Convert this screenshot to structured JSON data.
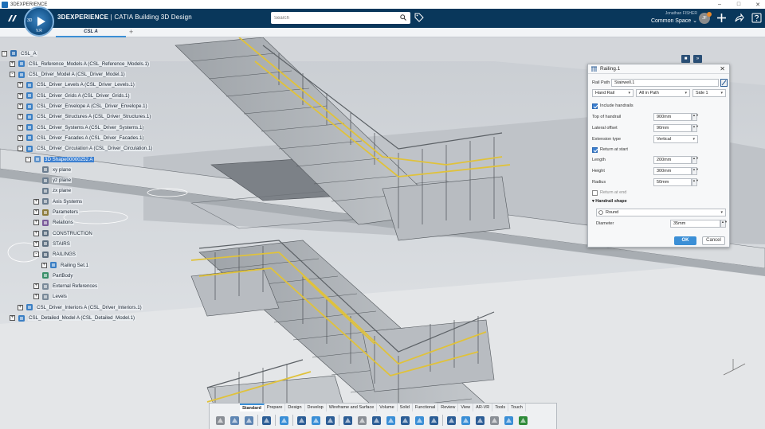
{
  "window": {
    "title": "3DEXPERIENCE",
    "controls": {
      "minimize": "–",
      "maximize": "□",
      "close": "✕"
    }
  },
  "header": {
    "brand_bold": "3DEXPERIENCE",
    "brand_rest": " | CATIA Building 3D Design",
    "compass_version": "V.R",
    "compass_side": "3D",
    "search_placeholder": "Search",
    "user_name": "Jonathan FISHER",
    "space": "Common Space",
    "space_chevron": "⌄",
    "avatar_initials": "JF",
    "accent": "#09375b"
  },
  "tabs": {
    "active_label": "CSL A",
    "add_label": "+"
  },
  "tree": {
    "rows": [
      {
        "level": 0,
        "toggle": "-",
        "icon": "product-root",
        "label": "CSL_A",
        "selected": false
      },
      {
        "level": 1,
        "toggle": "+",
        "icon": "product",
        "label": "CSL_Reference_Models A (CSL_Reference_Models.1)",
        "selected": false
      },
      {
        "level": 1,
        "toggle": "-",
        "icon": "product",
        "label": "CSL_Driver_Model A (CSL_Driver_Model.1)",
        "selected": false
      },
      {
        "level": 2,
        "toggle": "+",
        "icon": "product",
        "label": "CSL_Driver_Levels A (CSL_Driver_Levels.1)",
        "selected": false
      },
      {
        "level": 2,
        "toggle": "+",
        "icon": "product",
        "label": "CSL_Driver_Grids A (CSL_Driver_Grids.1)",
        "selected": false
      },
      {
        "level": 2,
        "toggle": "+",
        "icon": "product",
        "label": "CSL_Driver_Envelope A (CSL_Driver_Envelope.1)",
        "selected": false
      },
      {
        "level": 2,
        "toggle": "+",
        "icon": "product",
        "label": "CSL_Driver_Structures A (CSL_Driver_Structures.1)",
        "selected": false
      },
      {
        "level": 2,
        "toggle": "+",
        "icon": "product",
        "label": "CSL_Driver_Systems A (CSL_Driver_Systems.1)",
        "selected": false
      },
      {
        "level": 2,
        "toggle": "+",
        "icon": "product",
        "label": "CSL_Driver_Facades A (CSL_Driver_Facades.1)",
        "selected": false
      },
      {
        "level": 2,
        "toggle": "-",
        "icon": "product",
        "label": "CSL_Driver_Circulation A (CSL_Driver_Circulation.1)",
        "selected": false
      },
      {
        "level": 3,
        "toggle": "-",
        "icon": "shape",
        "label": "3D Shape00000252 A",
        "selected": true
      },
      {
        "level": 4,
        "toggle": "",
        "icon": "plane",
        "label": "xy plane",
        "selected": false
      },
      {
        "level": 4,
        "toggle": "",
        "icon": "plane",
        "label": "yz plane",
        "selected": false
      },
      {
        "level": 4,
        "toggle": "",
        "icon": "plane",
        "label": "zx plane",
        "selected": false
      },
      {
        "level": 4,
        "toggle": "+",
        "icon": "axis",
        "label": "Axis Systems",
        "selected": false
      },
      {
        "level": 4,
        "toggle": "+",
        "icon": "parameters",
        "label": "Parameters",
        "selected": false
      },
      {
        "level": 4,
        "toggle": "+",
        "icon": "relations",
        "label": "Relations",
        "selected": false
      },
      {
        "level": 4,
        "toggle": "+",
        "icon": "geoset",
        "label": "CONSTRUCTION",
        "selected": false
      },
      {
        "level": 4,
        "toggle": "+",
        "icon": "geoset",
        "label": "STAIRS",
        "selected": false
      },
      {
        "level": 4,
        "toggle": "-",
        "icon": "geoset",
        "label": "RAILINGS",
        "selected": false
      },
      {
        "level": 5,
        "toggle": "+",
        "icon": "railing",
        "label": "Railing Set.1",
        "selected": false
      },
      {
        "level": 4,
        "toggle": "",
        "icon": "partbody",
        "label": "PartBody",
        "selected": false
      },
      {
        "level": 4,
        "toggle": "+",
        "icon": "extref",
        "label": "External References",
        "selected": false
      },
      {
        "level": 4,
        "toggle": "+",
        "icon": "levels",
        "label": "Levels",
        "selected": false
      },
      {
        "level": 2,
        "toggle": "+",
        "icon": "product",
        "label": "CSL_Driver_Interiors A (CSL_Driver_Interiors.1)",
        "selected": false
      },
      {
        "level": 1,
        "toggle": "+",
        "icon": "product",
        "label": "CSL_Detailed_Model A (CSL_Detailed_Model.1)",
        "selected": false
      }
    ]
  },
  "dialog": {
    "title": "Railing.1",
    "close": "✕",
    "rail_path_label": "Rail Path",
    "rail_path_value": "Stairwell.1",
    "type_value": "Hand Rail",
    "scope_value": "All in Path",
    "side_value": "Side 1",
    "include_handrails_label": "Include handrails",
    "include_handrails": true,
    "top_of_handrail_label": "Top of handrail",
    "top_of_handrail_value": "900mm",
    "lateral_offset_label": "Lateral offset",
    "lateral_offset_value": "90mm",
    "extension_type_label": "Extension type",
    "extension_type_value": "Vertical",
    "return_at_start_label": "Return at start",
    "return_at_start": true,
    "length_label": "Length",
    "length_value": "200mm",
    "height_label": "Height",
    "height_value": "300mm",
    "radius_label": "Radius",
    "radius_value": "50mm",
    "return_at_end_label": "Return at end",
    "return_at_end": false,
    "handrail_shape_label": "Handrail shape",
    "shape_value": "Round",
    "diameter_label": "Diameter",
    "diameter_value": "35mm",
    "ok_label": "OK",
    "cancel_label": "Cancel",
    "spin_glyph": "▲▼",
    "arrow_glyph": "▾"
  },
  "action_bar": {
    "tabs": [
      "Standard",
      "Prepare",
      "Design",
      "Develop",
      "Wireframe and Surface",
      "Volume",
      "Solid",
      "Functional",
      "Review",
      "View",
      "AR-VR",
      "Tools",
      "Touch"
    ],
    "active_tab": "Standard",
    "icons": [
      {
        "name": "cut-icon",
        "color": "#8a8f96"
      },
      {
        "name": "copy-icon",
        "color": "#5f86b3"
      },
      {
        "name": "paste-icon",
        "color": "#5f86b3"
      },
      {
        "sep": true
      },
      {
        "name": "undo-icon",
        "color": "#2d5e96"
      },
      {
        "sep": true
      },
      {
        "name": "update-icon",
        "color": "#3b8fd6"
      },
      {
        "sep": true
      },
      {
        "name": "sketch-icon",
        "color": "#2d5e96"
      },
      {
        "name": "pad-icon",
        "color": "#3b8fd6"
      },
      {
        "name": "grid-icon",
        "color": "#2d5e96"
      },
      {
        "sep": true
      },
      {
        "name": "point-icon",
        "color": "#2d5e96"
      },
      {
        "name": "measure-icon",
        "color": "#8a8f96"
      },
      {
        "name": "cursor-icon",
        "color": "#2d5e96"
      },
      {
        "name": "paint-icon",
        "color": "#3b8fd6"
      },
      {
        "name": "material-icon",
        "color": "#2d5e96"
      },
      {
        "name": "render-icon",
        "color": "#3b8fd6"
      },
      {
        "name": "frame-icon",
        "color": "#2d5e96"
      },
      {
        "sep": true
      },
      {
        "name": "stair-icon",
        "color": "#2d5e96"
      },
      {
        "name": "beam-icon",
        "color": "#3b8fd6"
      },
      {
        "name": "plug-icon",
        "color": "#2d5e96"
      },
      {
        "name": "tag-tool-icon",
        "color": "#8a8f96"
      },
      {
        "name": "group-icon",
        "color": "#3b8fd6"
      },
      {
        "name": "save-icon",
        "color": "#2f8b3a"
      }
    ]
  }
}
